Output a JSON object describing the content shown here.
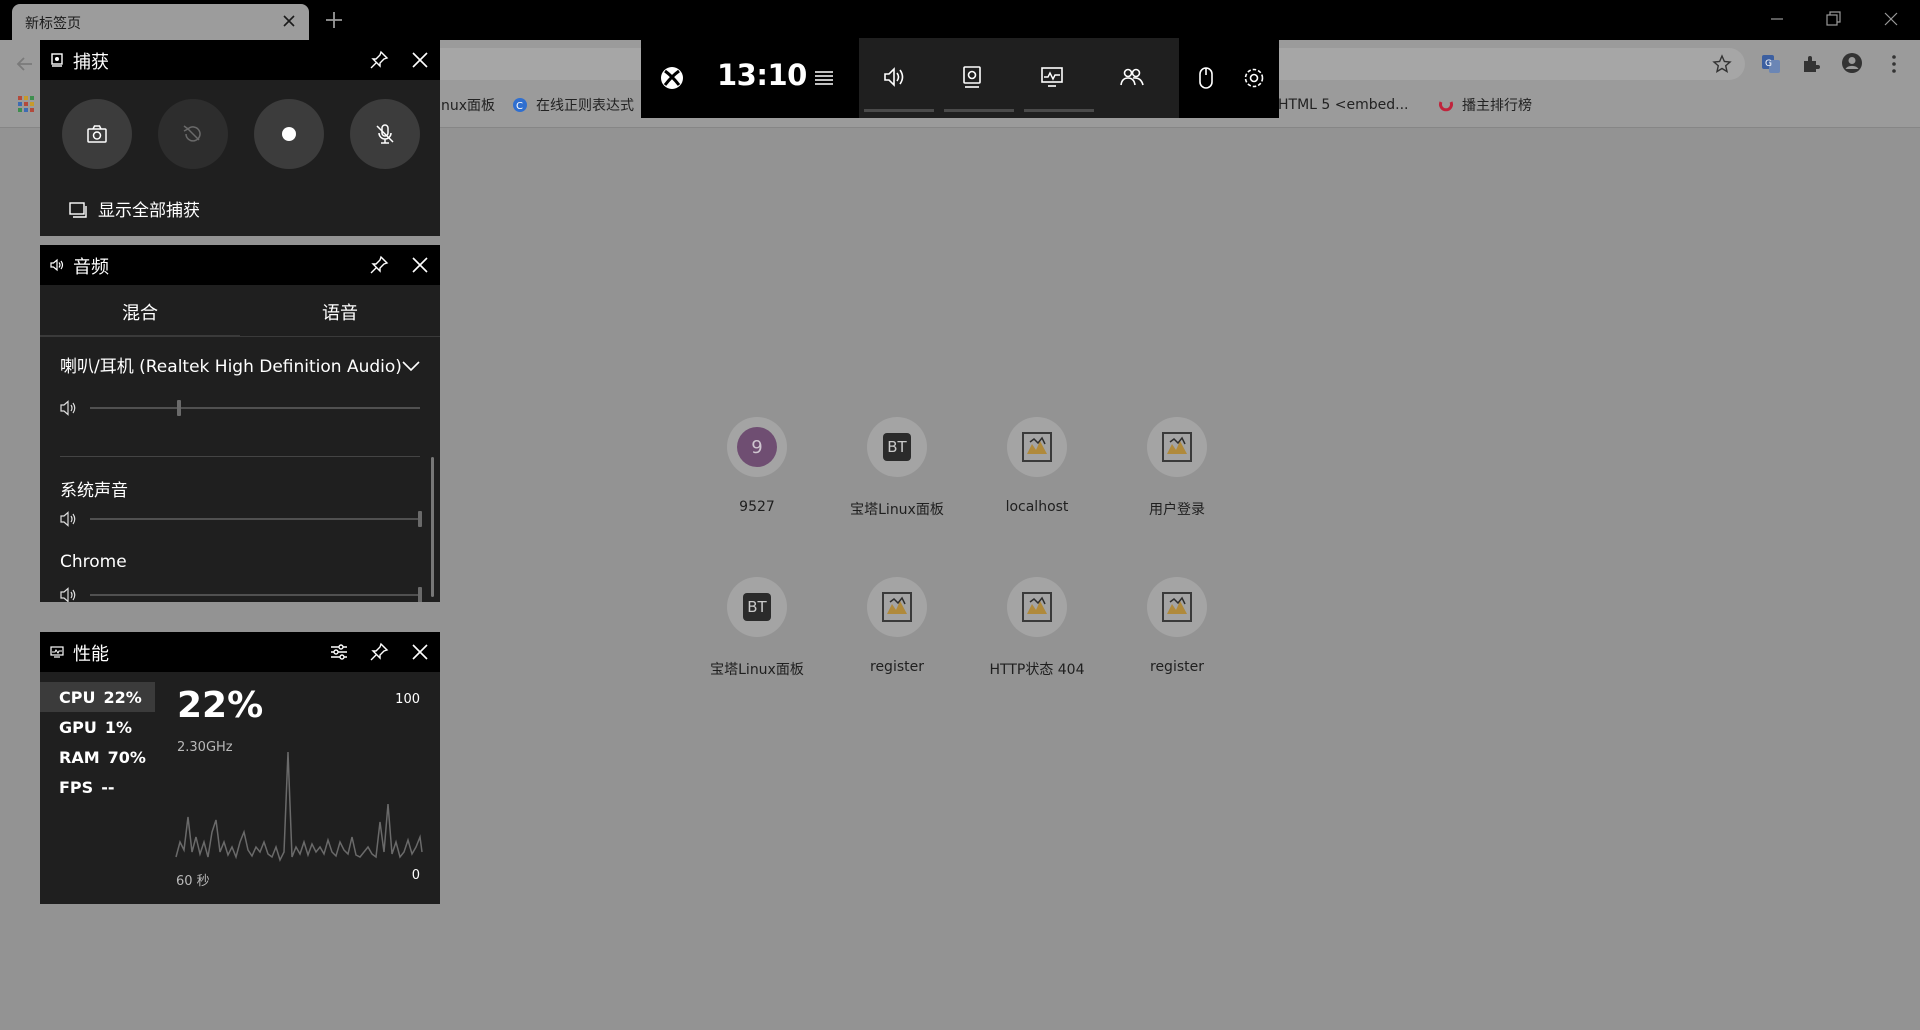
{
  "browser": {
    "tab_title": "新标签页",
    "bookmarks": [
      {
        "label": "nux面板",
        "color": "#8a8a8a"
      },
      {
        "label": "在线正则表达式",
        "color": "#2f6fd0"
      },
      {
        "label": "HTML 5 <embed...",
        "color": "#8a8a8a"
      },
      {
        "label": "播主排行榜",
        "color": "#c0243c"
      }
    ],
    "shortcuts": [
      {
        "label": "9527",
        "icon": "9",
        "kind": "number"
      },
      {
        "label": "宝塔Linux面板",
        "icon": "BT",
        "kind": "bt"
      },
      {
        "label": "localhost",
        "icon": "tomcat-icon",
        "kind": "img"
      },
      {
        "label": "用户登录",
        "icon": "tomcat-icon",
        "kind": "img"
      },
      {
        "label": "宝塔Linux面板",
        "icon": "BT",
        "kind": "bt"
      },
      {
        "label": "register",
        "icon": "tomcat-icon",
        "kind": "img"
      },
      {
        "label": "HTTP状态 404",
        "icon": "tomcat-icon",
        "kind": "img"
      },
      {
        "label": "register",
        "icon": "tomcat-icon",
        "kind": "img"
      }
    ]
  },
  "gamebar": {
    "time": "13:10",
    "icons": [
      "xbox-icon",
      "menu-icon",
      "audio-icon",
      "capture-icon",
      "performance-icon",
      "social-icon",
      "mouse-icon",
      "settings-icon"
    ]
  },
  "capture": {
    "title": "捕获",
    "buttons": [
      "screenshot-icon",
      "record-last-icon",
      "record-icon",
      "mic-off-icon"
    ],
    "show_all": "显示全部捕获"
  },
  "audio": {
    "title": "音频",
    "tabs": [
      "混合",
      "语音"
    ],
    "device": "喇叭/耳机 (Realtek High Definition Audio)",
    "device_volume": 0.27,
    "apps": [
      {
        "name": "系统声音",
        "volume": 1.0
      },
      {
        "name": "Chrome",
        "volume": 1.0
      }
    ]
  },
  "performance": {
    "title": "性能",
    "metrics": [
      {
        "name": "CPU",
        "value": "22%"
      },
      {
        "name": "GPU",
        "value": "1%"
      },
      {
        "name": "RAM",
        "value": "70%"
      },
      {
        "name": "FPS",
        "value": "--"
      }
    ],
    "big_value": "22%",
    "frequency": "2.30GHz",
    "scale_max": "100",
    "scale_min": "0",
    "time_span": "60 秒"
  }
}
